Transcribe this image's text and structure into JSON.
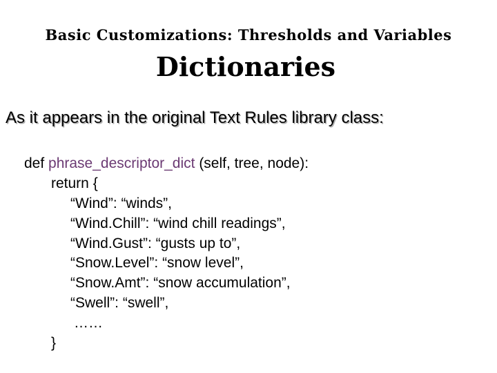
{
  "slide": {
    "supertitle": "Basic Customizations: Thresholds and Variables",
    "title": "Dictionaries",
    "subheading": "As it appears in the original Text Rules library class:"
  },
  "code": {
    "def_keyword": "def ",
    "function_name": "phrase_descriptor_dict",
    "signature_rest": " (self, tree, node):",
    "return_line": "return {",
    "entries": [
      "“Wind”: “winds”,",
      "“Wind.Chill”: “wind chill readings”,",
      "“Wind.Gust”: “gusts up to”,",
      "“Snow.Level”: “snow level”,",
      "“Snow.Amt”: “snow accumulation”,",
      "“Swell”: “swell”,"
    ],
    "ellipsis": "……",
    "closing_brace": "}"
  },
  "colors": {
    "function_name": "#6b3a73",
    "text": "#000000"
  }
}
